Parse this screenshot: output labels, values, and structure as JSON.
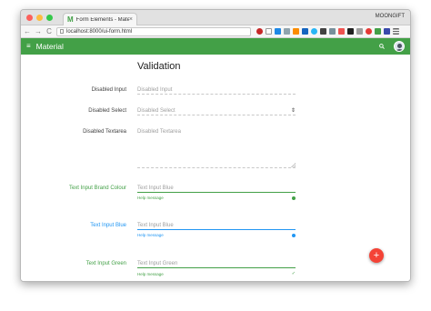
{
  "browser": {
    "tab_title": "Form Elements - Material",
    "tab_favicon": "M",
    "tab_close": "×",
    "profile_name": "MOONGIFT",
    "url": "localhost:8000/ui-form.html",
    "back": "←",
    "forward": "→",
    "reload": "C",
    "colors": {
      "close": "#fc605b",
      "minimize": "#fdbc40",
      "maximize": "#34c84a"
    }
  },
  "appbar": {
    "menu_icon": "≡",
    "title": "Material",
    "search_icon": "search-icon",
    "color": "#43a047"
  },
  "form": {
    "heading": "Validation",
    "disabled_input": {
      "label": "Disabled Input",
      "placeholder": "Disabled Input"
    },
    "disabled_select": {
      "label": "Disabled Select",
      "placeholder": "Disabled Select",
      "arrow": "⇕"
    },
    "disabled_textarea": {
      "label": "Disabled Textarea",
      "placeholder": "Disabled Textarea"
    },
    "brand_input": {
      "label": "Text Input Brand Colour",
      "placeholder": "Text Input Blue",
      "help": "Help message",
      "color": "#43a047"
    },
    "blue_input": {
      "label": "Text Input Blue",
      "placeholder": "Text Input Blue",
      "help": "Help message",
      "color": "#2196f3"
    },
    "green_input": {
      "label": "Text Input Green",
      "placeholder": "Text Input Green",
      "help": "Help message",
      "check": "✓",
      "color": "#43a047"
    }
  },
  "fab": {
    "label": "+",
    "color": "#f44336"
  }
}
